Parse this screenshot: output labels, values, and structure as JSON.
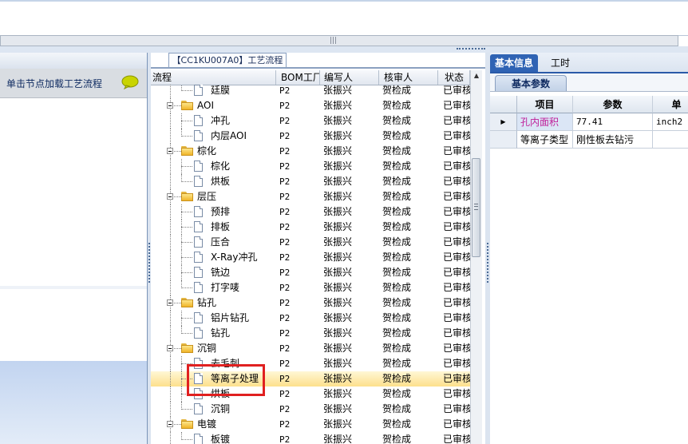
{
  "middle_panel": {
    "tab_title": "【CC1KU007A0】工艺流程",
    "columns": [
      "流程",
      "BOM工厂",
      "编写人",
      "核审人",
      "状态"
    ],
    "rows": [
      {
        "type": "leaf",
        "depth": 2,
        "name": "廷膜",
        "bom": "P2",
        "writer": "张振兴",
        "auditor": "贺检成",
        "status": "已审核"
      },
      {
        "type": "folder",
        "depth": 1,
        "name": "AOI",
        "bom": "P2",
        "writer": "张振兴",
        "auditor": "贺检成",
        "status": "已审核"
      },
      {
        "type": "leaf",
        "depth": 2,
        "name": "冲孔",
        "bom": "P2",
        "writer": "张振兴",
        "auditor": "贺检成",
        "status": "已审核"
      },
      {
        "type": "leaf",
        "depth": 2,
        "name": "内层AOI",
        "bom": "P2",
        "writer": "张振兴",
        "auditor": "贺检成",
        "status": "已审核"
      },
      {
        "type": "folder",
        "depth": 1,
        "name": "棕化",
        "bom": "P2",
        "writer": "张振兴",
        "auditor": "贺检成",
        "status": "已审核"
      },
      {
        "type": "leaf",
        "depth": 2,
        "name": "棕化",
        "bom": "P2",
        "writer": "张振兴",
        "auditor": "贺检成",
        "status": "已审核"
      },
      {
        "type": "leaf",
        "depth": 2,
        "name": "烘板",
        "bom": "P2",
        "writer": "张振兴",
        "auditor": "贺检成",
        "status": "已审核"
      },
      {
        "type": "folder",
        "depth": 1,
        "name": "层压",
        "bom": "P2",
        "writer": "张振兴",
        "auditor": "贺检成",
        "status": "已审核"
      },
      {
        "type": "leaf",
        "depth": 2,
        "name": "预排",
        "bom": "P2",
        "writer": "张振兴",
        "auditor": "贺检成",
        "status": "已审核"
      },
      {
        "type": "leaf",
        "depth": 2,
        "name": "排板",
        "bom": "P2",
        "writer": "张振兴",
        "auditor": "贺检成",
        "status": "已审核"
      },
      {
        "type": "leaf",
        "depth": 2,
        "name": "压合",
        "bom": "P2",
        "writer": "张振兴",
        "auditor": "贺检成",
        "status": "已审核"
      },
      {
        "type": "leaf",
        "depth": 2,
        "name": "X-Ray冲孔",
        "bom": "P2",
        "writer": "张振兴",
        "auditor": "贺检成",
        "status": "已审核"
      },
      {
        "type": "leaf",
        "depth": 2,
        "name": "铣边",
        "bom": "P2",
        "writer": "张振兴",
        "auditor": "贺检成",
        "status": "已审核"
      },
      {
        "type": "leaf",
        "depth": 2,
        "name": "打字唛",
        "bom": "P2",
        "writer": "张振兴",
        "auditor": "贺检成",
        "status": "已审核"
      },
      {
        "type": "folder",
        "depth": 1,
        "name": "钻孔",
        "bom": "P2",
        "writer": "张振兴",
        "auditor": "贺检成",
        "status": "已审核"
      },
      {
        "type": "leaf",
        "depth": 2,
        "name": "铝片钻孔",
        "bom": "P2",
        "writer": "张振兴",
        "auditor": "贺检成",
        "status": "已审核"
      },
      {
        "type": "leaf",
        "depth": 2,
        "name": "钻孔",
        "bom": "P2",
        "writer": "张振兴",
        "auditor": "贺检成",
        "status": "已审核"
      },
      {
        "type": "folder",
        "depth": 1,
        "name": "沉铜",
        "bom": "P2",
        "writer": "张振兴",
        "auditor": "贺检成",
        "status": "已审核"
      },
      {
        "type": "leaf",
        "depth": 2,
        "name": "去毛刺",
        "bom": "P2",
        "writer": "张振兴",
        "auditor": "贺检成",
        "status": "已审核"
      },
      {
        "type": "leaf",
        "depth": 2,
        "name": "等离子处理",
        "bom": "P2",
        "writer": "张振兴",
        "auditor": "贺检成",
        "status": "已审核",
        "selected": true
      },
      {
        "type": "leaf",
        "depth": 2,
        "name": "烘板",
        "bom": "P2",
        "writer": "张振兴",
        "auditor": "贺检成",
        "status": "已审核"
      },
      {
        "type": "leaf",
        "depth": 2,
        "name": "沉铜",
        "bom": "P2",
        "writer": "张振兴",
        "auditor": "贺检成",
        "status": "已审核"
      },
      {
        "type": "folder",
        "depth": 1,
        "name": "电镀",
        "bom": "P2",
        "writer": "张振兴",
        "auditor": "贺检成",
        "status": "已审核"
      },
      {
        "type": "leaf",
        "depth": 2,
        "name": "板镀",
        "bom": "P2",
        "writer": "张振兴",
        "auditor": "贺检成",
        "status": "已审核"
      },
      {
        "type": "folder",
        "depth": 1,
        "name": "外层干膜",
        "bom": "P2",
        "writer": "张振兴",
        "auditor": "贺检成",
        "status": "已审核"
      }
    ]
  },
  "left_panel": {
    "toolbar_label": "单击节点加载工艺流程"
  },
  "right_panel": {
    "tabs": [
      "基本信息",
      "工时"
    ],
    "sub_tab": "基本参数",
    "table": {
      "columns": [
        "项目",
        "参数",
        "单"
      ],
      "rows": [
        {
          "item": "孔内面积",
          "param": "77.41",
          "unit": "inch2",
          "current": true
        },
        {
          "item": "等离子类型",
          "param": "刚性板去钻污",
          "unit": ""
        }
      ]
    }
  },
  "colors": {
    "highlight_box": "#e02020",
    "selected_row": "#fde08c",
    "active_tab": "#2f63b4",
    "item_link": "#c0209a"
  }
}
